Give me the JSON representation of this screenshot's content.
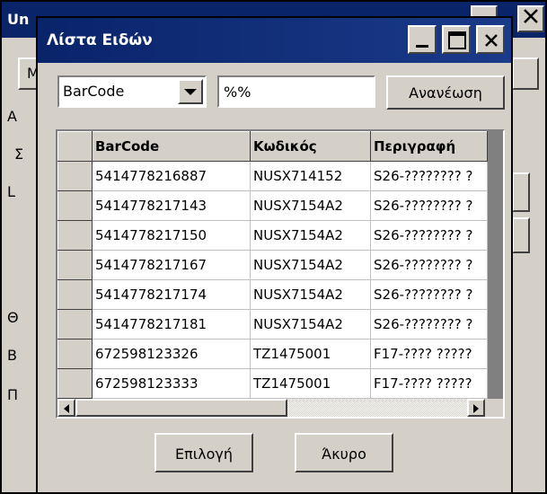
{
  "background_window": {
    "title": "Un",
    "button_stub": "M",
    "side_letters": [
      "A",
      "Σ",
      "L",
      "Θ",
      "B",
      "Π"
    ]
  },
  "dialog": {
    "title": "Λίστα Ειδών",
    "field_select": {
      "selected": "BarCode"
    },
    "search": {
      "value": "%%"
    },
    "refresh_label": "Ανανέωση",
    "grid": {
      "columns": [
        "BarCode",
        "Κωδικός",
        "Περιγραφή"
      ],
      "rows": [
        [
          "5414778216887",
          "NUSX714152",
          "S26-???????? ?"
        ],
        [
          "5414778217143",
          "NUSX7154A2",
          "S26-???????? ?"
        ],
        [
          "5414778217150",
          "NUSX7154A2",
          "S26-???????? ?"
        ],
        [
          "5414778217167",
          "NUSX7154A2",
          "S26-???????? ?"
        ],
        [
          "5414778217174",
          "NUSX7154A2",
          "S26-???????? ?"
        ],
        [
          "5414778217181",
          "NUSX7154A2",
          "S26-???????? ?"
        ],
        [
          "672598123326",
          "TZ1475001",
          "F17-???? ?????"
        ],
        [
          "672598123333",
          "TZ1475001",
          "F17-???? ?????"
        ]
      ],
      "vertical_scroll_fraction": 0.42,
      "horizontal_scroll_fraction": 0.0
    },
    "ok_label": "Επιλογή",
    "cancel_label": "Άκυρο"
  },
  "colors": {
    "titlebar": "#0a246a",
    "face": "#d4d0c8"
  },
  "icons": {
    "minimize": "minimize-icon",
    "maximize": "maximize-icon",
    "close": "close-icon",
    "dropdown": "chevron-down-icon"
  }
}
